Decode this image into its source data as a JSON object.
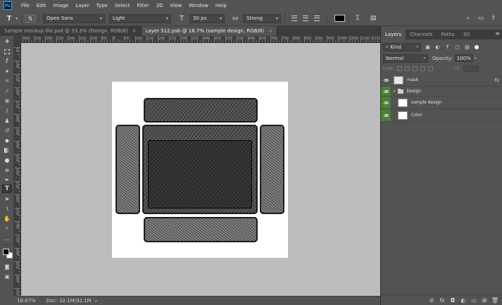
{
  "menu": [
    "File",
    "Edit",
    "Image",
    "Layer",
    "Type",
    "Select",
    "Filter",
    "3D",
    "View",
    "Window",
    "Help"
  ],
  "app_logo": "Ps",
  "options": {
    "font_family": "Open Sans",
    "font_style": "Light",
    "font_size": "30 px",
    "antialias": "Strong",
    "text_tool_glyph": "T",
    "orient_glyph": "⇅",
    "size_glyph": "T",
    "aa_glyph": "aa"
  },
  "tabs": [
    {
      "label": "Sample mockup file.psd @ 33.3% (Design, RGB/8)",
      "close": "×"
    },
    {
      "label": "Layer 512.psb @ 16.7% (sample design, RGB/8)",
      "close": "×"
    }
  ],
  "tab_collapse": "»",
  "ruler_top": [
    "400",
    "350",
    "300",
    "250",
    "200",
    "150",
    "100",
    "50",
    "0",
    "50",
    "100",
    "150",
    "200",
    "250",
    "300",
    "350",
    "400",
    "450",
    "500",
    "550",
    "600",
    "650",
    "700",
    "750",
    "800",
    "850",
    "900",
    "950",
    "1000",
    "1050",
    "1100",
    "1150",
    "1200"
  ],
  "ruler_left": [
    "50",
    "100",
    "150",
    "200",
    "250",
    "300",
    "350",
    "400",
    "450",
    "500",
    "550",
    "600",
    "650",
    "700",
    "750",
    "800",
    "850",
    "900",
    "950"
  ],
  "status": {
    "zoom": "16.67%",
    "doc": "Doc: 32.1M/32.1M",
    "arrow": ">"
  },
  "panel": {
    "tabs": [
      "Layers",
      "Channels",
      "Paths",
      "3D"
    ],
    "menu": "≡",
    "kind": "Kind",
    "blend_mode": "Normal",
    "opacity_label": "Opacity:",
    "opacity_value": "100%",
    "lock_label": "Lock:",
    "fill_label": "Fill:",
    "layers": [
      {
        "name": "mask",
        "fx": "fx"
      },
      {
        "name": "Design"
      },
      {
        "name": "sample design"
      },
      {
        "name": "Color"
      }
    ]
  }
}
